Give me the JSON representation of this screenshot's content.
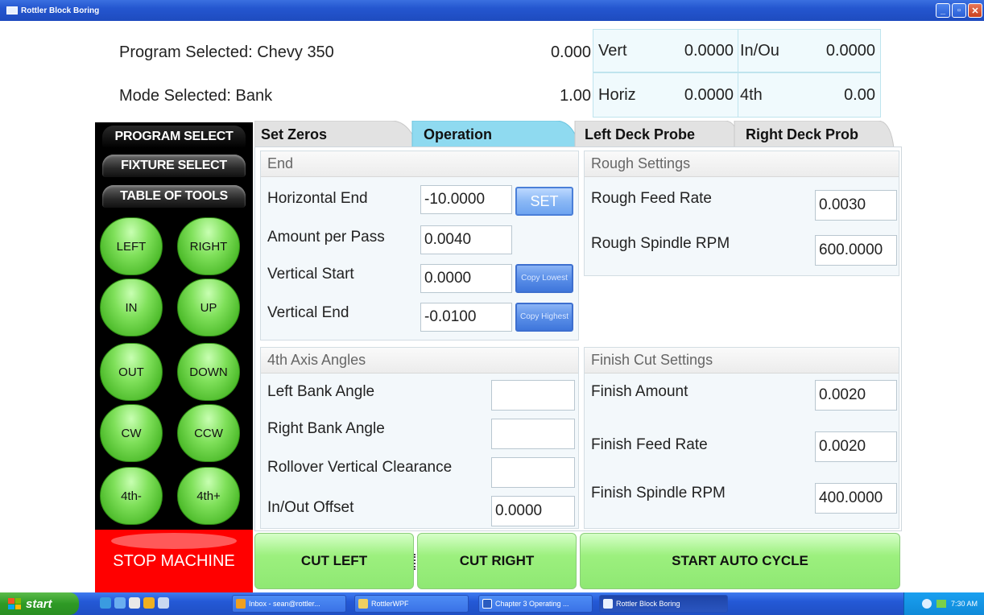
{
  "window": {
    "title": "Rottler Block Boring"
  },
  "header": {
    "program_label": "Program Selected: Chevy 350",
    "mode_label": "Mode Selected: Bank",
    "value_1": "0.000",
    "value_2": "1.00",
    "dro": {
      "vert_label": "Vert",
      "vert_value": "0.0000",
      "inout_label": "In/Ou",
      "inout_value": "0.0000",
      "horiz_label": "Horiz",
      "horiz_value": "0.0000",
      "fourth_label": "4th",
      "fourth_value": "0.00"
    }
  },
  "sidebar": {
    "tabs": [
      "PROGRAM SELECT",
      "FIXTURE SELECT",
      "TABLE OF TOOLS"
    ],
    "jog_buttons": [
      "LEFT",
      "RIGHT",
      "IN",
      "UP",
      "OUT",
      "DOWN",
      "CW",
      "CCW",
      "4th-",
      "4th+"
    ],
    "stop_label": "STOP MACHINE"
  },
  "tabs": {
    "set_zeros": "Set Zeros",
    "operation": "Operation",
    "left_deck_probe": "Left Deck Probe",
    "right_deck_probe": "Right Deck Prob"
  },
  "end_group": {
    "title": "End",
    "horizontal_end_label": "Horizontal End",
    "horizontal_end_value": "-10.0000",
    "set_label": "SET",
    "amount_per_pass_label": "Amount per Pass",
    "amount_per_pass_value": "0.0040",
    "vertical_start_label": "Vertical Start",
    "vertical_start_value": "0.0000",
    "copy_lowest_label": "Copy Lowest",
    "vertical_end_label": "Vertical End",
    "vertical_end_value": "-0.0100",
    "copy_highest_label": "Copy Highest"
  },
  "rough_group": {
    "title": "Rough Settings",
    "feed_rate_label": "Rough Feed Rate",
    "feed_rate_value": "0.0030",
    "spindle_label": "Rough Spindle RPM",
    "spindle_value": "600.0000"
  },
  "axis_group": {
    "title": "4th Axis Angles",
    "left_bank_label": "Left Bank Angle",
    "left_bank_value": "",
    "right_bank_label": "Right Bank Angle",
    "right_bank_value": "",
    "rollover_label": "Rollover Vertical Clearance",
    "rollover_value": "",
    "inout_offset_label": "In/Out Offset",
    "inout_offset_value": "0.0000"
  },
  "finish_group": {
    "title": "Finish Cut Settings",
    "amount_label": "Finish Amount",
    "amount_value": "0.0020",
    "feed_rate_label": "Finish Feed Rate",
    "feed_rate_value": "0.0020",
    "spindle_label": "Finish Spindle RPM",
    "spindle_value": "400.0000"
  },
  "bottom": {
    "cut_left": "CUT LEFT",
    "cut_right": "CUT RIGHT",
    "start_auto": "START AUTO CYCLE"
  },
  "taskbar": {
    "start": "start",
    "tasks": [
      "Inbox - sean@rottler...",
      "RottlerWPF",
      "Chapter 3 Operating ...",
      "Rottler Block Boring"
    ],
    "clock": "7:30 AM"
  },
  "colors": {
    "accent_green": "#7fe05a",
    "stop_red": "#ff0000",
    "titlebar_blue": "#2456cf"
  }
}
